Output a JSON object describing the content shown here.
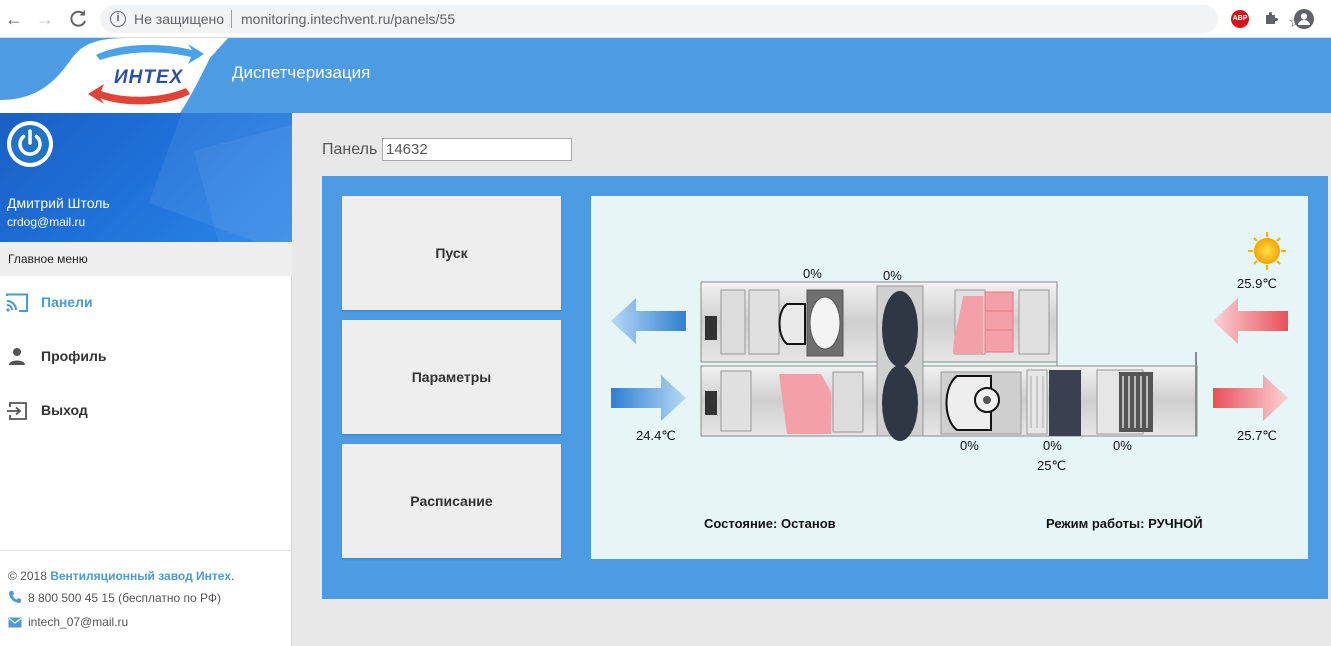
{
  "browser": {
    "security_label": "Не защищено",
    "url": "monitoring.intechvent.ru/panels/55",
    "extension_badge": "ABP"
  },
  "header": {
    "logo_text": "ИНТЕХ",
    "title": "Диспетчеризация"
  },
  "sidebar": {
    "user_name": "Дмитрий Штоль",
    "user_email": "crdog@mail.ru",
    "menu_heading": "Главное меню",
    "items": [
      {
        "label": "Панели",
        "icon": "cast-icon",
        "active": true
      },
      {
        "label": "Профиль",
        "icon": "person-icon",
        "active": false
      },
      {
        "label": "Выход",
        "icon": "exit-icon",
        "active": false
      }
    ],
    "footer": {
      "copyright_prefix": "© 2018",
      "company": "Вентиляционный завод Интех",
      "copyright_suffix": ".",
      "phone": "8 800 500 45 15 (бесплатно по РФ)",
      "email": "intech_07@mail.ru"
    }
  },
  "main": {
    "panel_label": "Панель",
    "panel_value": "14632",
    "buttons": {
      "start": "Пуск",
      "params": "Параметры",
      "schedule": "Расписание"
    },
    "scheme": {
      "outdoor_temp": "25.9℃",
      "exhaust_temp": "24.4℃",
      "supply_temp": "25.7℃",
      "heater_temp": "25℃",
      "damper_exhaust": "0%",
      "recuperator": "0%",
      "supply_fan": "0%",
      "heater": "0%",
      "cooler": "0%",
      "status": "Состояние: Останов",
      "mode": "Режим работы: РУЧНОЙ"
    }
  },
  "colors": {
    "brand_blue": "#4c9be3",
    "link_blue": "#4a9ad4",
    "scheme_bg": "#e6f5f6",
    "warm_red": "#f08080",
    "cool_blue": "#4a90d9"
  }
}
